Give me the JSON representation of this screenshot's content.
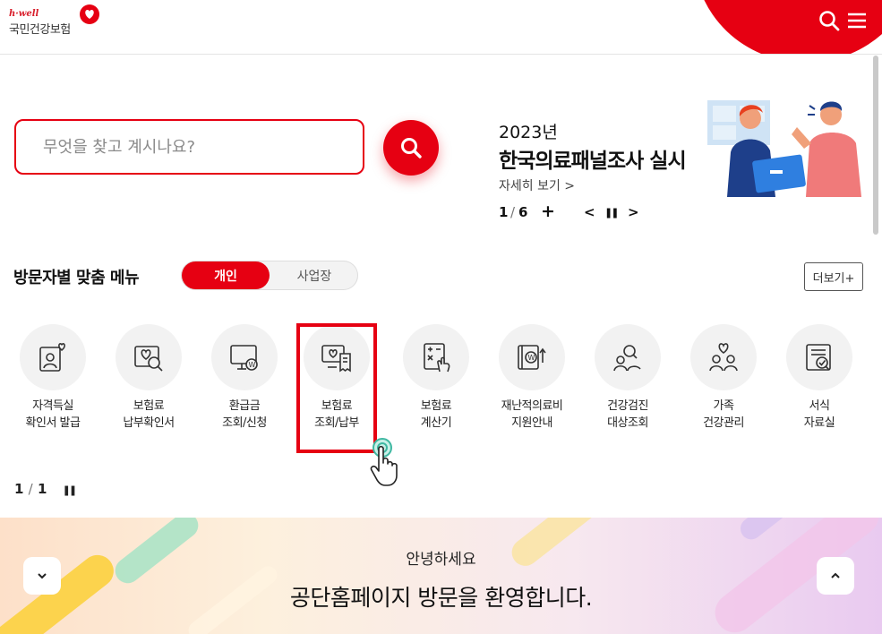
{
  "header": {
    "logo_sub": "h·well",
    "logo_main": "국민건강보험",
    "search_icon": "search-icon",
    "menu_icon": "hamburger-menu-icon",
    "accent_color": "#e60012"
  },
  "search": {
    "placeholder": "무엇을 찾고 계시나요?",
    "button_icon": "search-icon"
  },
  "banner": {
    "year": "2023년",
    "title": "한국의료패널조사 실시",
    "link": "자세히 보기 >",
    "page_current": "1",
    "page_separator": "/",
    "page_total": "6",
    "plus_label": "+",
    "prev_label": "<",
    "pause_label": "❚❚",
    "next_label": ">"
  },
  "visitor_menu": {
    "title": "방문자별 맞춤 메뉴",
    "tab_personal": "개인",
    "tab_business": "사업장",
    "active_tab": "개인",
    "more_label": "더보기+",
    "items": [
      {
        "line1": "자격득실",
        "line2": "확인서 발급",
        "icon": "person-heart-card-icon"
      },
      {
        "line1": "보험료",
        "line2": "납부확인서",
        "icon": "heart-magnifier-icon"
      },
      {
        "line1": "환급금",
        "line2": "조회/신청",
        "icon": "monitor-won-icon"
      },
      {
        "line1": "보험료",
        "line2": "조회/납부",
        "icon": "monitor-heart-receipt-icon"
      },
      {
        "line1": "보험료",
        "line2": "계산기",
        "icon": "calculator-hand-icon"
      },
      {
        "line1": "재난적의료비",
        "line2": "지원안내",
        "icon": "won-arrow-card-icon"
      },
      {
        "line1": "건강검진",
        "line2": "대상조회",
        "icon": "people-search-icon"
      },
      {
        "line1": "가족",
        "line2": "건강관리",
        "icon": "family-heart-icon"
      },
      {
        "line1": "서식",
        "line2": "자료실",
        "icon": "document-check-icon"
      }
    ],
    "pager_current": "1",
    "pager_separator": "/",
    "pager_total": "1",
    "pager_pause": "❚❚"
  },
  "welcome": {
    "small_text": "안녕하세요",
    "big_text": "공단홈페이지 방문을 환영합니다.",
    "down_icon": "chevron-down-icon",
    "up_icon": "chevron-up-icon"
  }
}
